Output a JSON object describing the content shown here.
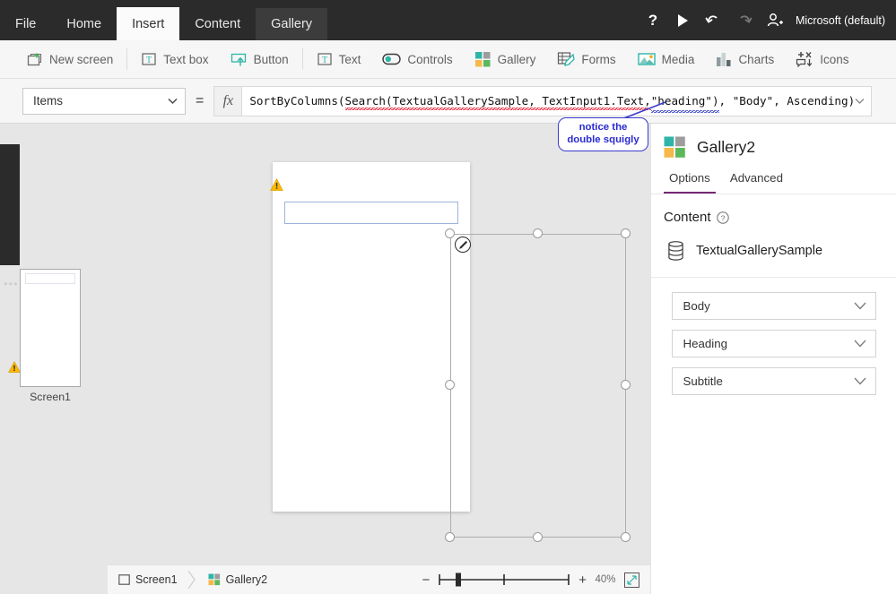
{
  "app": {
    "account_label": "Microsoft (default)"
  },
  "menubar": {
    "tabs": [
      {
        "label": "File",
        "state": "normal"
      },
      {
        "label": "Home",
        "state": "normal"
      },
      {
        "label": "Insert",
        "state": "active"
      },
      {
        "label": "Content",
        "state": "normal"
      },
      {
        "label": "Gallery",
        "state": "contextual"
      }
    ],
    "actions": [
      {
        "name": "help-icon",
        "glyph": "?"
      },
      {
        "name": "play-icon",
        "glyph": "play"
      },
      {
        "name": "undo-icon",
        "glyph": "undo"
      },
      {
        "name": "redo-icon",
        "glyph": "redo",
        "disabled": true
      },
      {
        "name": "share-user-icon",
        "glyph": "user-add"
      }
    ]
  },
  "ribbon": {
    "items": [
      {
        "label": "New screen",
        "icon": "new-screen-icon"
      },
      {
        "label": "Text box",
        "icon": "text-box-icon"
      },
      {
        "label": "Button",
        "icon": "button-icon"
      },
      {
        "label": "Text",
        "icon": "text-icon"
      },
      {
        "label": "Controls",
        "icon": "controls-icon"
      },
      {
        "label": "Gallery",
        "icon": "gallery-icon"
      },
      {
        "label": "Forms",
        "icon": "forms-icon"
      },
      {
        "label": "Media",
        "icon": "media-icon"
      },
      {
        "label": "Charts",
        "icon": "charts-icon"
      },
      {
        "label": "Icons",
        "icon": "icons-icon"
      }
    ]
  },
  "formula_bar": {
    "property": "Items",
    "equals": "=",
    "fx": "fx",
    "formula_segments": [
      {
        "text": "SortByColumns(",
        "squiggly": "none"
      },
      {
        "text": "Search(TextualGallerySample, TextInput1.Text, ",
        "squiggly": "red"
      },
      {
        "text": "\"heading\")",
        "squiggly": "both"
      },
      {
        "text": ", \"Body\", Ascending)",
        "squiggly": "none"
      }
    ],
    "formula_full": "SortByColumns(Search(TextualGallerySample, TextInput1.Text, \"heading\"), \"Body\", Ascending)"
  },
  "annotation": {
    "line1": "notice the",
    "line2": "double squigly",
    "color": "#2a2ad0"
  },
  "left_rail": {
    "screen_label": "Screen1",
    "overflow_glyph": "•••",
    "warning_icon": "warning-triangle-icon"
  },
  "canvas": {
    "text_input_value": "",
    "warning_icon": "warning-triangle-icon",
    "edit_badge_icon": "pencil-icon"
  },
  "status_bar": {
    "breadcrumb": [
      {
        "label": "Screen1",
        "icon": "screen-icon"
      },
      {
        "label": "Gallery2",
        "icon": "gallery-icon"
      }
    ],
    "zoom_out": "−",
    "zoom_in": "+",
    "zoom_percent": "40%",
    "fit_icon": "fit-screen-icon"
  },
  "right_panel": {
    "title": "Gallery2",
    "icon": "gallery-icon",
    "tabs": [
      {
        "label": "Options",
        "active": true
      },
      {
        "label": "Advanced",
        "active": false
      }
    ],
    "section_title": "Content",
    "section_help_glyph": "?",
    "data_source": {
      "name": "TextualGallerySample",
      "icon": "database-icon"
    },
    "field_dropdowns": [
      {
        "value": "Body"
      },
      {
        "value": "Heading"
      },
      {
        "value": "Subtitle"
      }
    ]
  },
  "colors": {
    "topbar_bg": "#2b2b2b",
    "ribbon_bg": "#f6f6f6",
    "accent_purple": "#742774",
    "teal": "#2eb5a8",
    "warning_yellow": "#ffb900",
    "squiggly_red": "#e81123",
    "squiggly_blue": "#2b39c9"
  }
}
